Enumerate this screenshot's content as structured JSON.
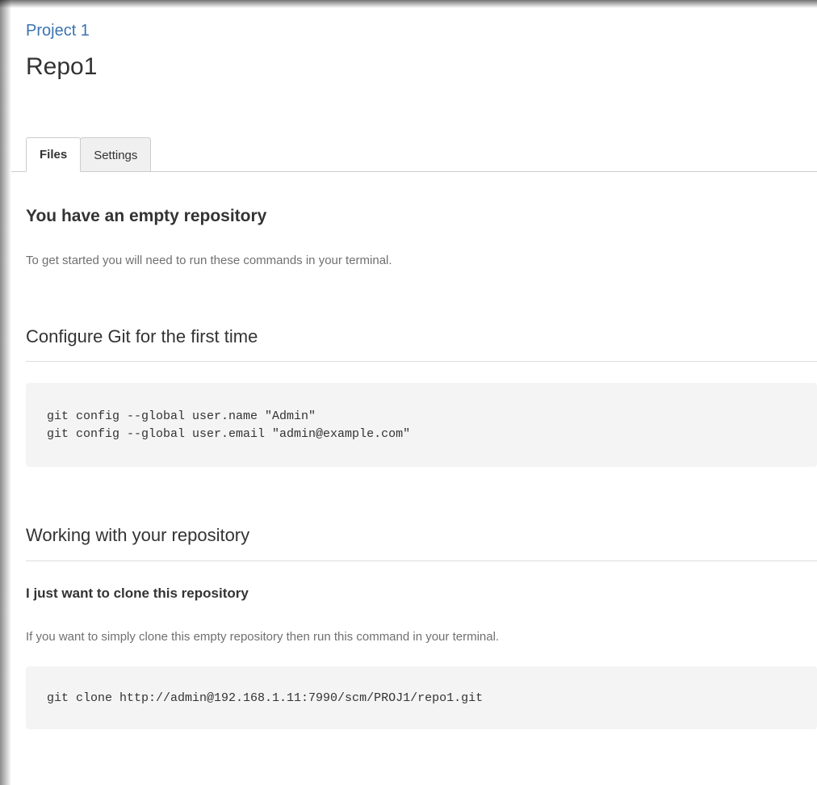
{
  "header": {
    "project_link": "Project 1",
    "repo_title": "Repo1"
  },
  "tabs": [
    {
      "label": "Files",
      "active": true
    },
    {
      "label": "Settings",
      "active": false
    }
  ],
  "empty_repo": {
    "heading": "You have an empty repository",
    "intro": "To get started you will need to run these commands in your terminal."
  },
  "configure": {
    "heading": "Configure Git for the first time",
    "lines": [
      "git config --global user.name \"Admin\"",
      "git config --global user.email \"admin@example.com\""
    ]
  },
  "working": {
    "heading": "Working with your repository",
    "subheading": "I just want to clone this repository",
    "intro": "If you want to simply clone this empty repository then run this command in your terminal.",
    "clone_command": "git clone http://admin@192.168.1.11:7990/scm/PROJ1/repo1.git"
  },
  "colors": {
    "link": "#3b73af",
    "code_bg": "#f4f4f4",
    "muted_text": "#707070"
  }
}
